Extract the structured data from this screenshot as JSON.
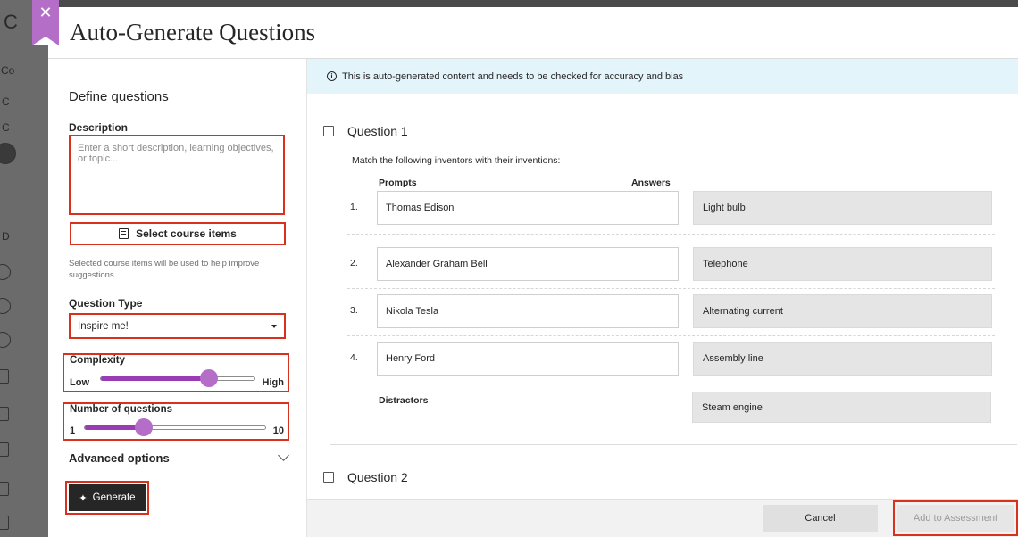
{
  "dialog": {
    "title": "Auto-Generate Questions",
    "close_label": "✕"
  },
  "backdrop": {
    "letters": [
      "C",
      "Co",
      "C",
      "C",
      "D"
    ]
  },
  "define": {
    "section_title": "Define questions",
    "description_label": "Description",
    "description_value": "",
    "description_placeholder": "Enter a short description, learning objectives, or topic...",
    "select_course_items_label": "Select course items",
    "helper_text": "Selected course items will be used to help improve suggestions.",
    "question_type_label": "Question Type",
    "question_type_value": "Inspire me!",
    "complexity": {
      "label": "Complexity",
      "min_label": "Low",
      "max_label": "High",
      "level": 0.7
    },
    "num_questions": {
      "label": "Number of questions",
      "min_label": "1",
      "max_label": "10",
      "value_fraction": 0.33
    },
    "advanced_options_label": "Advanced options",
    "generate_label": "Generate"
  },
  "content": {
    "banner_text": "This is auto-generated content and needs to be checked for accuracy and bias",
    "question1": {
      "title": "Question 1",
      "instruction": "Match the following inventors with their inventions:",
      "prompts_header": "Prompts",
      "answers_header": "Answers",
      "pairs": [
        {
          "num": "1.",
          "prompt": "Thomas Edison",
          "answer": "Light bulb"
        },
        {
          "num": "2.",
          "prompt": "Alexander Graham Bell",
          "answer": "Telephone"
        },
        {
          "num": "3.",
          "prompt": "Nikola Tesla",
          "answer": "Alternating current"
        },
        {
          "num": "4.",
          "prompt": "Henry Ford",
          "answer": "Assembly line"
        }
      ],
      "distractors_label": "Distractors",
      "distractors": [
        "Steam engine"
      ]
    },
    "question2": {
      "title": "Question 2"
    }
  },
  "footer": {
    "cancel_label": "Cancel",
    "add_label": "Add to Assessment"
  },
  "colors": {
    "accent": "#b46ec8",
    "slider_fill": "#9a3db4",
    "highlight_border": "#d8321f",
    "banner_bg": "#e4f4fb"
  }
}
